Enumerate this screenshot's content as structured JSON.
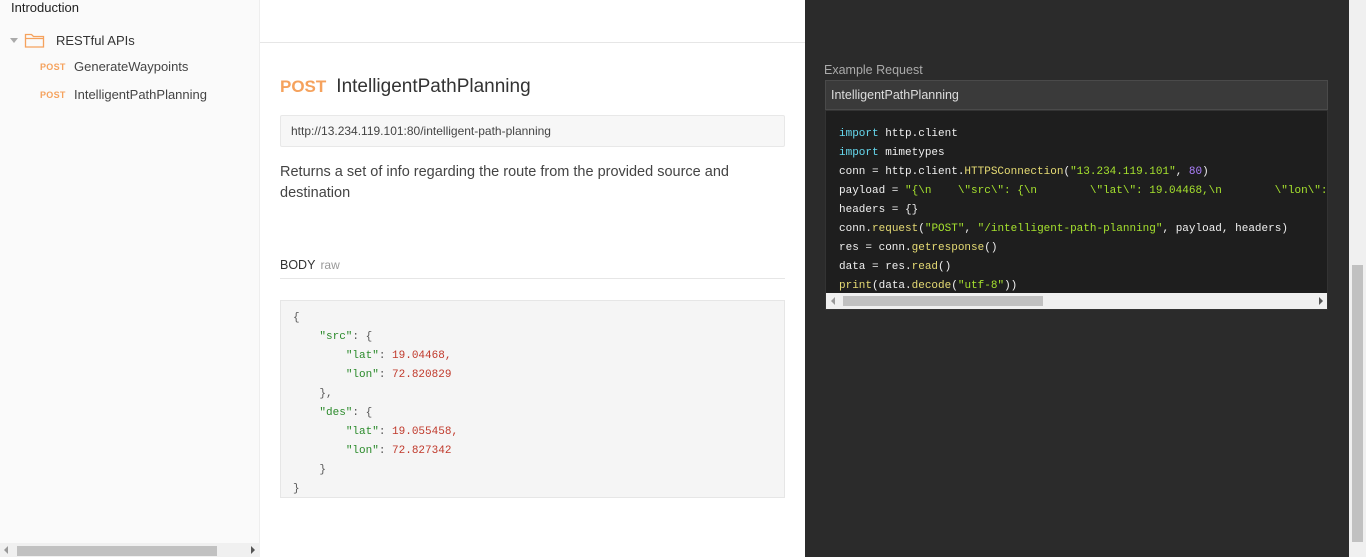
{
  "sidebar": {
    "intro": "Introduction",
    "folder": {
      "label": "RESTful APIs",
      "icon": "folder-icon"
    },
    "items": [
      {
        "method": "POST",
        "label": "GenerateWaypoints"
      },
      {
        "method": "POST",
        "label": "IntelligentPathPlanning"
      }
    ]
  },
  "request": {
    "method": "POST",
    "name": "IntelligentPathPlanning",
    "url": "http://13.234.119.101:80/intelligent-path-planning",
    "description": "Returns a set of info regarding the route from the provided source and destination",
    "body_label": "BODY",
    "body_mode": "raw",
    "body": {
      "open": "{",
      "src_key": "\"src\"",
      "src_lat_key": "\"lat\"",
      "src_lat": "19.04468,",
      "src_lon_key": "\"lon\"",
      "src_lon": "72.820829",
      "src_close": "},",
      "des_key": "\"des\"",
      "des_lat_key": "\"lat\"",
      "des_lat": "19.055458,",
      "des_lon_key": "\"lon\"",
      "des_lon": "72.827342",
      "des_close": "}",
      "close": "}"
    }
  },
  "example": {
    "label": "Example Request",
    "tab": "IntelligentPathPlanning",
    "code": {
      "l1_kw": "import",
      "l1_rest": " http.client",
      "l2_kw": "import",
      "l2_rest": " mimetypes",
      "l3_a": "conn = http.client.",
      "l3_fn": "HTTPSConnection",
      "l3_b": "(",
      "l3_s": "\"13.234.119.101\"",
      "l3_c": ", ",
      "l3_n": "80",
      "l3_d": ")",
      "l4_a": "payload = ",
      "l4_s": "\"{\\n    \\\"src\\\": {\\n        \\\"lat\\\": 19.04468,\\n        \\\"lon\\\":",
      "l5": "headers = {}",
      "l6_a": "conn.",
      "l6_fn": "request",
      "l6_b": "(",
      "l6_s1": "\"POST\"",
      "l6_c": ", ",
      "l6_s2": "\"/intelligent-path-planning\"",
      "l6_d": ", payload, headers)",
      "l7_a": "res = conn.",
      "l7_fn": "getresponse",
      "l7_b": "()",
      "l8_a": "data = res.",
      "l8_fn": "read",
      "l8_b": "()",
      "l9_fn": "print",
      "l9_a": "(data.",
      "l9_fn2": "decode",
      "l9_b": "(",
      "l9_s": "\"utf-8\"",
      "l9_c": "))"
    }
  }
}
